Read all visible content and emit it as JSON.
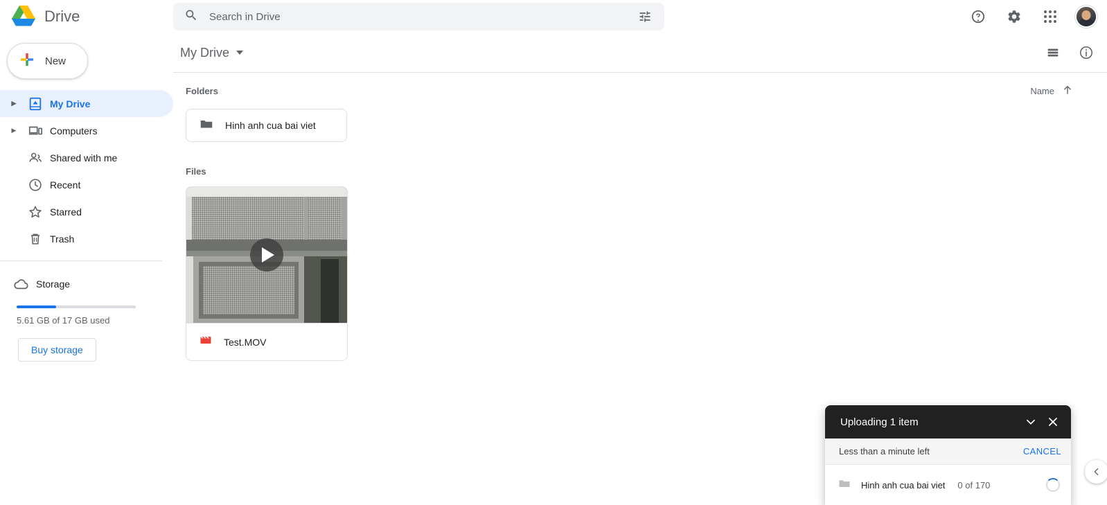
{
  "app": {
    "brand_title": "Drive",
    "logo_icon": "google-drive-logo"
  },
  "search": {
    "placeholder": "Search in Drive",
    "value": "",
    "search_icon": "search-icon",
    "options_icon": "tune-options-icon"
  },
  "topbar_actions": {
    "help_icon": "help-circle-icon",
    "settings_icon": "gear-icon",
    "apps_icon": "apps-grid-icon",
    "avatar_icon": "user-avatar"
  },
  "sidebar": {
    "new_button": {
      "label": "New",
      "icon": "plus-icon"
    },
    "items": [
      {
        "label": "My Drive",
        "icon": "my-drive-icon",
        "active": true,
        "expandable": true
      },
      {
        "label": "Computers",
        "icon": "computers-icon",
        "active": false,
        "expandable": true
      },
      {
        "label": "Shared with me",
        "icon": "people-icon",
        "active": false,
        "expandable": false
      },
      {
        "label": "Recent",
        "icon": "clock-icon",
        "active": false,
        "expandable": false
      },
      {
        "label": "Starred",
        "icon": "star-icon",
        "active": false,
        "expandable": false
      },
      {
        "label": "Trash",
        "icon": "trash-icon",
        "active": false,
        "expandable": false
      }
    ],
    "storage": {
      "label": "Storage",
      "icon": "cloud-icon",
      "used_text": "5.61 GB of 17 GB used",
      "used_percent": 33,
      "buy_label": "Buy storage"
    }
  },
  "main": {
    "breadcrumb": "My Drive",
    "breadcrumb_caret_icon": "chevron-down-icon",
    "list_view_icon": "list-view-icon",
    "details_icon": "info-circle-icon",
    "folders_label": "Folders",
    "files_label": "Files",
    "sort": {
      "label": "Name",
      "direction_icon": "arrow-up-icon"
    },
    "folders": [
      {
        "name": "Hinh anh cua bai viet",
        "icon": "folder-icon"
      }
    ],
    "files": [
      {
        "name": "Test.MOV",
        "icon": "video-file-icon",
        "play_icon": "play-icon",
        "thumbnail_alt": "video-thumbnail"
      }
    ]
  },
  "upload_toast": {
    "title": "Uploading 1 item",
    "collapse_icon": "chevron-down-icon",
    "close_icon": "close-icon",
    "time_remaining": "Less than a minute left",
    "cancel_label": "CANCEL",
    "rows": [
      {
        "name": "Hinh anh cua bai viet",
        "count": "0 of 170",
        "icon": "folder-icon",
        "status_icon": "progress-spinner"
      }
    ]
  },
  "side_panel_toggle": {
    "icon": "chevron-left-icon"
  },
  "colors": {
    "accent_blue": "#1a73e8",
    "active_pill": "#e8f0fe",
    "toast_header": "#212121",
    "text_secondary": "#5f6368",
    "border": "#e0e0e0"
  }
}
